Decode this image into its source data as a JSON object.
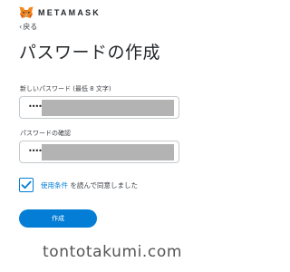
{
  "header": {
    "logo_icon": "metamask-fox-icon",
    "brand": "METAMASK"
  },
  "back": {
    "chevron": "‹",
    "label": "戻る"
  },
  "title": "パスワードの作成",
  "password_field": {
    "label": "新しいパスワード (最低 8 文字)",
    "value": "••••••"
  },
  "confirm_field": {
    "label": "パスワードの確認",
    "value": "••••••"
  },
  "terms": {
    "checked": true,
    "link_text": "使用条件",
    "text": " を読んで同意しました"
  },
  "create_button": {
    "label": "作成"
  },
  "watermark": "tontotakumi.com",
  "colors": {
    "accent": "#037dd6",
    "text": "#24272a",
    "fox_orange": "#e2761b"
  }
}
